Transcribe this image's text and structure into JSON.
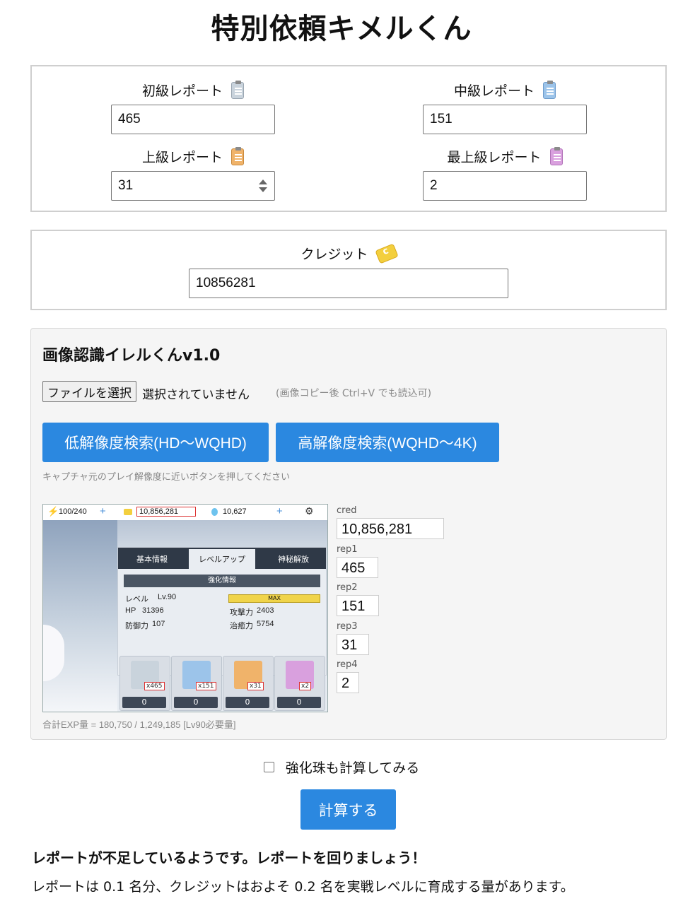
{
  "title": "特別依頼キメルくん",
  "reports": {
    "beginner": {
      "label": "初級レポート",
      "value": "465"
    },
    "intermediate": {
      "label": "中級レポート",
      "value": "151"
    },
    "advanced": {
      "label": "上級レポート",
      "value": "31"
    },
    "top": {
      "label": "最上級レポート",
      "value": "2"
    }
  },
  "credit": {
    "label": "クレジット",
    "value": "10856281"
  },
  "recognizer": {
    "title": "画像認識イレルくんv1.0",
    "file_button": "ファイルを選択",
    "file_status": "選択されていません",
    "paste_hint": "(画像コピー後 Ctrl+V でも読込可)",
    "low_res_button": "低解像度検索(HD〜WQHD)",
    "high_res_button": "高解像度検索(WQHD〜4K)",
    "resolution_note": "キャプチャ元のプレイ解像度に近いボタンを押してください",
    "preview": {
      "stamina": "100/240",
      "credits": "10,856,281",
      "gems": "10,627",
      "tabs": [
        "基本情報",
        "レベルアップ",
        "神秘解放"
      ],
      "section": "強化情報",
      "level_label": "レベル",
      "level_value": "Lv.90",
      "max": "MAX",
      "hp_label": "HP",
      "hp_value": "31396",
      "atk_label": "攻撃力",
      "atk_value": "2403",
      "def_label": "防御力",
      "def_value": "107",
      "heal_label": "治癒力",
      "heal_value": "5754",
      "item_counts": [
        "x465",
        "x151",
        "x31",
        "x2"
      ],
      "item_zero": "0"
    },
    "ocr": {
      "cred_label": "cred",
      "cred_value": "10,856,281",
      "rep1_label": "rep1",
      "rep1_value": "465",
      "rep2_label": "rep2",
      "rep2_value": "151",
      "rep3_label": "rep3",
      "rep3_value": "31",
      "rep4_label": "rep4",
      "rep4_value": "2"
    },
    "exp_summary": "合計EXP量 = 180,750 / 1,249,185 [Lv90必要量]"
  },
  "orb_checkbox_label": "強化珠も計算してみる",
  "calculate_button": "計算する",
  "result_message": "レポートが不足しているようです。レポートを回りましょう！",
  "result_detail": "レポートは 0.1 名分、クレジットはおよそ 0.2 名を実戦レベルに育成する量があります。",
  "colors": {
    "accent": "#2b88e0",
    "report_beginner": "#c9d3dc",
    "report_intermediate": "#9cc4ea",
    "report_advanced": "#f0b36a",
    "report_top": "#d9a0de"
  }
}
